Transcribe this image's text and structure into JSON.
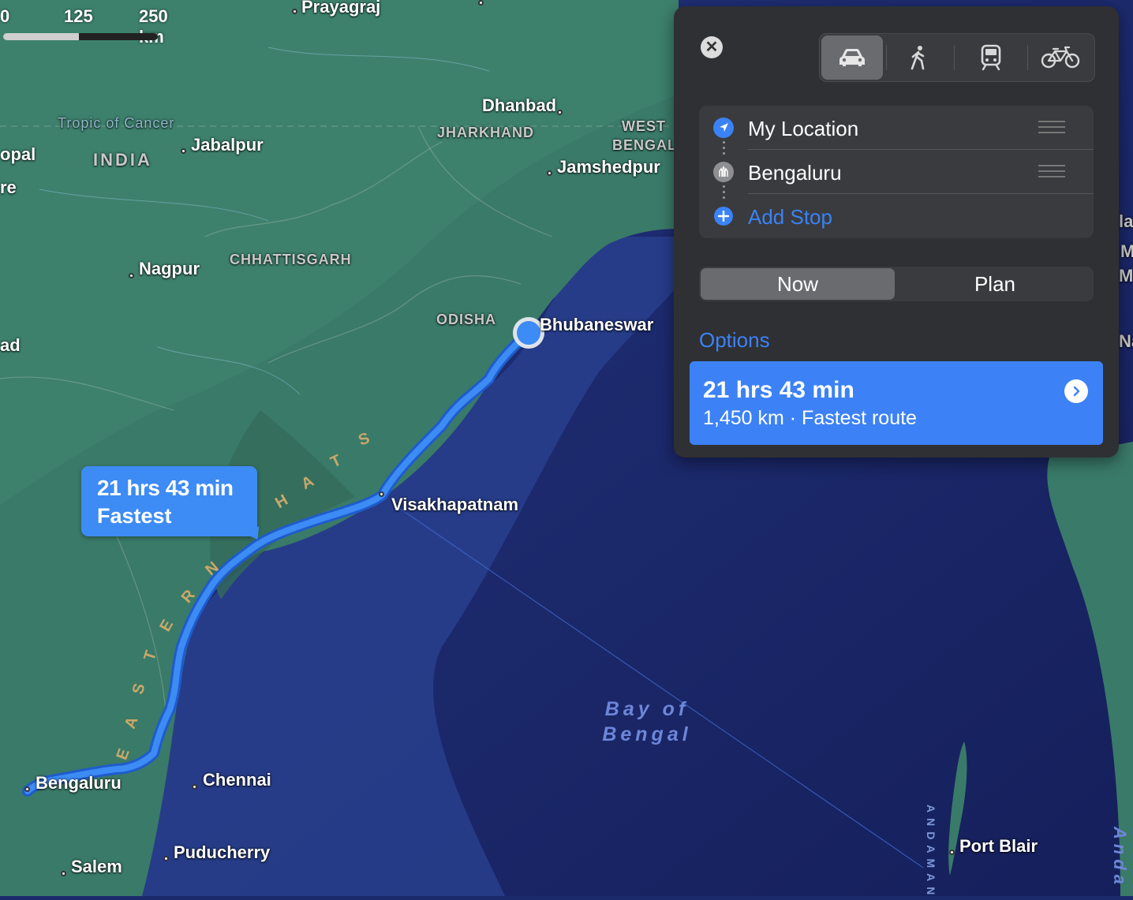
{
  "map": {
    "scale": {
      "zero": "0",
      "mid": "125",
      "end": "250 km"
    },
    "tropic_label": "Tropic of Cancer",
    "country_label": "INDIA",
    "states": [
      "JHARKHAND",
      "WEST",
      "BENGAL",
      "CHHATTISGARH",
      "ODISHA"
    ],
    "cities": {
      "prayagraj": "Prayagraj",
      "dhanbad": "Dhanbad",
      "jabalpur": "Jabalpur",
      "jamshedpur": "Jamshedpur",
      "nagpur": "Nagpur",
      "bhubaneswar": "Bhubaneswar",
      "visakhapatnam": "Visakhapatnam",
      "bengaluru": "Bengaluru",
      "chennai": "Chennai",
      "puducherry": "Puducherry",
      "salem": "Salem",
      "port_blair": "Port Blair",
      "hyderabad": "Hyderabad"
    },
    "ghats_letters": [
      "E",
      "A",
      "S",
      "T",
      "E",
      "R",
      "N",
      "G",
      "H",
      "A",
      "T",
      "S"
    ],
    "sea_label_line1": "Bay of",
    "sea_label_line2": "Bengal",
    "edge_fragments": {
      "left1": "opal",
      "left2": "re",
      "left3": "ad",
      "right1": "la",
      "right2": "M",
      "right3": "M",
      "right4": "Na"
    },
    "andaman_vertical": "ANDAMAN",
    "andaman_right": "Anda",
    "route_color": "#3d8bf5"
  },
  "callout": {
    "duration": "21 hrs 43 min",
    "label": "Fastest"
  },
  "panel": {
    "close_icon": "close-icon",
    "modes": [
      {
        "name": "drive",
        "icon": "car-icon",
        "selected": true
      },
      {
        "name": "walk",
        "icon": "walk-icon",
        "selected": false
      },
      {
        "name": "transit",
        "icon": "train-icon",
        "selected": false
      },
      {
        "name": "cycle",
        "icon": "bicycle-icon",
        "selected": false
      }
    ],
    "origin": "My Location",
    "destination": "Bengaluru",
    "add_stop": "Add Stop",
    "time_options": [
      "Now",
      "Plan"
    ],
    "time_selected": "Now",
    "options_heading": "Options",
    "route": {
      "duration": "21 hrs 43 min",
      "details": "1,450 km · Fastest route"
    },
    "accent": "#3b82f6"
  }
}
